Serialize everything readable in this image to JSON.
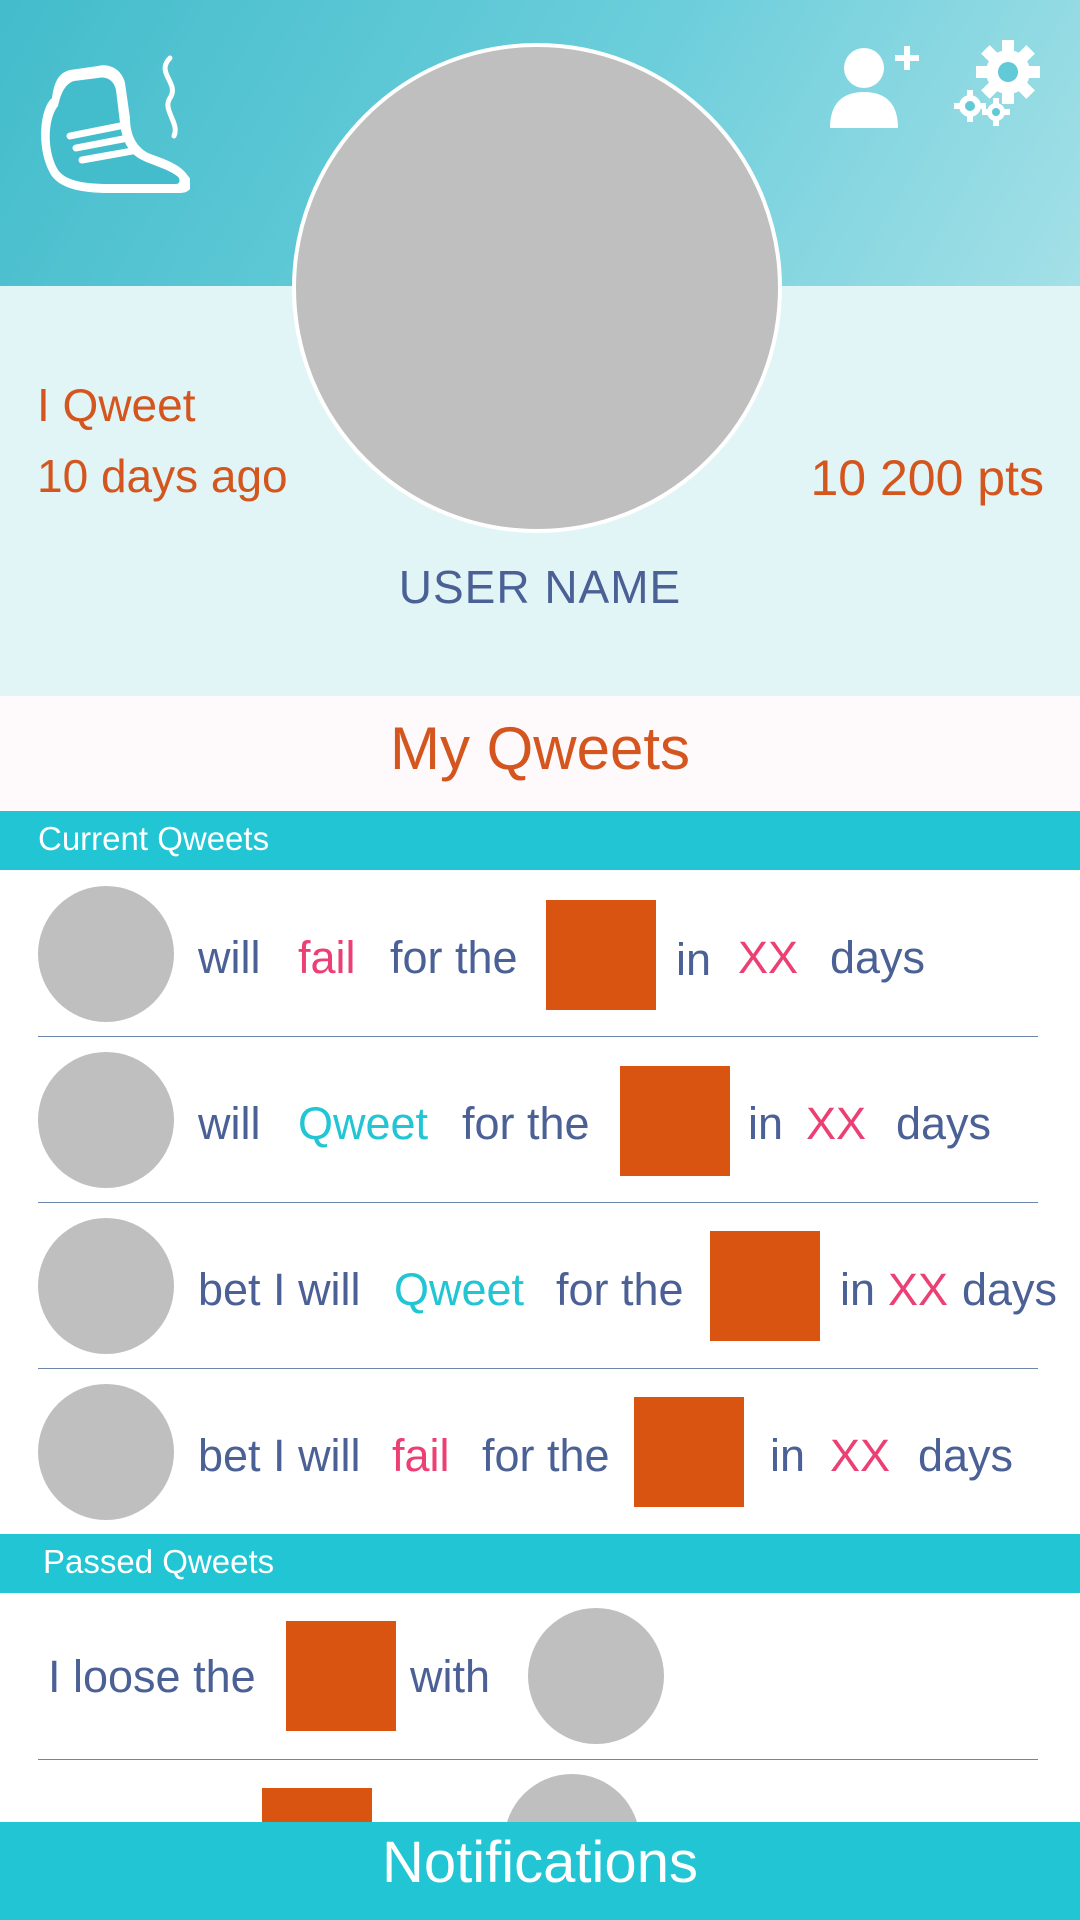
{
  "header": {
    "logo_icon": "sneaker-logo-icon",
    "add_friend_icon": "add-user-icon",
    "settings_icon": "gears-icon",
    "colors": {
      "start": "#43bccb",
      "end": "#a4e0e7"
    }
  },
  "profile": {
    "last_qweet_label": "I Qweet",
    "last_qweet_time": "10 days ago",
    "points": "10 200 pts",
    "user_name": "USER NAME"
  },
  "my_qweets": {
    "title": "My Qweets"
  },
  "current": {
    "title": "Current Qweets",
    "rows": [
      {
        "w1": "will",
        "w2": "fail",
        "w3": "for the",
        "w4": "in",
        "w5": "XX",
        "w6": "days"
      },
      {
        "w1": "will",
        "w2": "Qweet",
        "w3": "for the",
        "w4": "in",
        "w5": "XX",
        "w6": "days"
      },
      {
        "w1": "bet I will",
        "w2": "Qweet",
        "w3": "for the",
        "w4": "in",
        "w5": "XX",
        "w6": "days"
      },
      {
        "w1": "bet I will",
        "w2": "fail",
        "w3": "for the",
        "w4": "in",
        "w5": "XX",
        "w6": "days"
      }
    ]
  },
  "passed": {
    "title": "Passed Qweets",
    "rows": [
      {
        "w1": "I loose the",
        "w2": "with"
      }
    ]
  },
  "footer": {
    "notifications_label": "Notifications"
  },
  "colors": {
    "accent": "#21c5d3",
    "orange": "#d95410",
    "pink": "#ec3f73",
    "navy_text": "#4b6196"
  }
}
